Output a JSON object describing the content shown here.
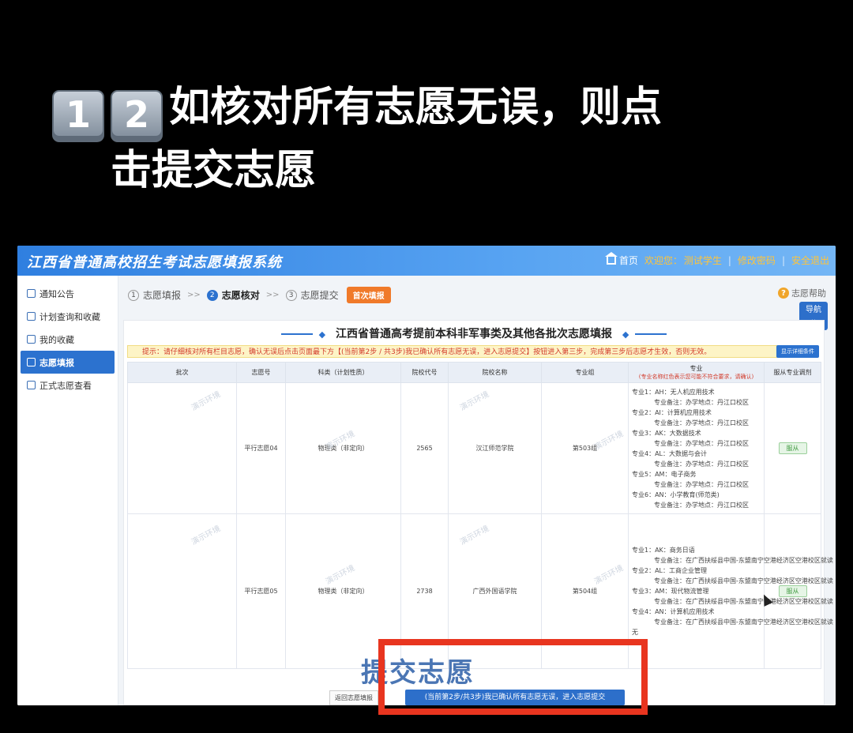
{
  "caption": {
    "key1": "1",
    "key2": "2",
    "line1": "如核对所有志愿无误，则点",
    "line2": "击提交志愿"
  },
  "app": {
    "title": "江西省普通高校招生考试志愿填报系统",
    "nav": {
      "home": "首页",
      "welcome": "欢迎您：",
      "user": "测试学生",
      "change_password": "修改密码",
      "logout": "安全退出"
    }
  },
  "sidebar": {
    "items": [
      {
        "label": "通知公告"
      },
      {
        "label": "计划查询和收藏"
      },
      {
        "label": "我的收藏"
      },
      {
        "label": "志愿填报"
      },
      {
        "label": "正式志愿查看"
      }
    ]
  },
  "steps": {
    "s1_num": "1",
    "s1": "志愿填报",
    "s2_num": "2",
    "s2": "志愿核对",
    "s3_num": "3",
    "s3": "志愿提交",
    "badge": "首次填报",
    "arrow": ">>"
  },
  "help": "志愿帮助",
  "guide": "导航",
  "panel": {
    "title": "江西省普通高考提前本科非军事类及其他各批次志愿填报",
    "tip": "提示：请仔细核对所有栏目志愿，确认无误后点击页面最下方【(当前第2步 / 共3步)我已确认所有志愿无误，进入志愿提交】按钮进入第三步，完成第三步后志愿才生效，否则无效。",
    "tip_button": "显示详细条件"
  },
  "table": {
    "headers": {
      "batch": "批次",
      "vol_no": "志愿号",
      "subject": "科类（计划性质）",
      "school_code": "院校代号",
      "school_name": "院校名称",
      "group": "专业组",
      "major": "专业",
      "major_note": "(专业名称红色表示您可能不符合要求，请确认)",
      "adjust": "服从专业调剂"
    },
    "rows": [
      {
        "vol_no": "平行志愿04",
        "subject": "物理类（非定向）",
        "school_code": "2565",
        "school_name": "汉江师范学院",
        "group": "第503组",
        "adjust": "服从",
        "majors": [
          {
            "name": "专业1：AH：无人机应用技术",
            "note": "专业备注：办学地点：丹江口校区"
          },
          {
            "name": "专业2：AI：计算机应用技术",
            "note": "专业备注：办学地点：丹江口校区"
          },
          {
            "name": "专业3：AK：大数据技术",
            "note": "专业备注：办学地点：丹江口校区"
          },
          {
            "name": "专业4：AL：大数据与会计",
            "note": "专业备注：办学地点：丹江口校区"
          },
          {
            "name": "专业5：AM：电子商务",
            "note": "专业备注：办学地点：丹江口校区"
          },
          {
            "name": "专业6：AN：小学教育(师范类)",
            "note": "专业备注：办学地点：丹江口校区"
          }
        ]
      },
      {
        "vol_no": "平行志愿05",
        "subject": "物理类（非定向）",
        "school_code": "2738",
        "school_name": "广西外国语学院",
        "group": "第504组",
        "adjust": "服从",
        "majors": [
          {
            "name": "专业1：AK：商务日语",
            "note": "专业备注：在广西扶绥县中国-东盟南宁空港经济区空港校区就读"
          },
          {
            "name": "专业2：AL：工商企业管理",
            "note": "专业备注：在广西扶绥县中国-东盟南宁空港经济区空港校区就读"
          },
          {
            "name": "专业3：AM：现代物流管理",
            "note": "专业备注：在广西扶绥县中国-东盟南宁空港经济区空港校区就读"
          },
          {
            "name": "专业4：AN：计算机应用技术",
            "note": "专业备注：在广西扶绥县中国-东盟南宁空港经济区空港校区就读"
          }
        ]
      }
    ],
    "tail": "无"
  },
  "bottom": {
    "overlay": "提交志愿",
    "back": "返回志愿填报",
    "submit": "(当前第2步/共3步)我已确认所有志愿无误，进入志愿提交"
  },
  "watermark": "演示环境",
  "colors": {
    "accent": "#2c72cf",
    "highlight": "#e8351f",
    "badge": "#f07a2a"
  }
}
